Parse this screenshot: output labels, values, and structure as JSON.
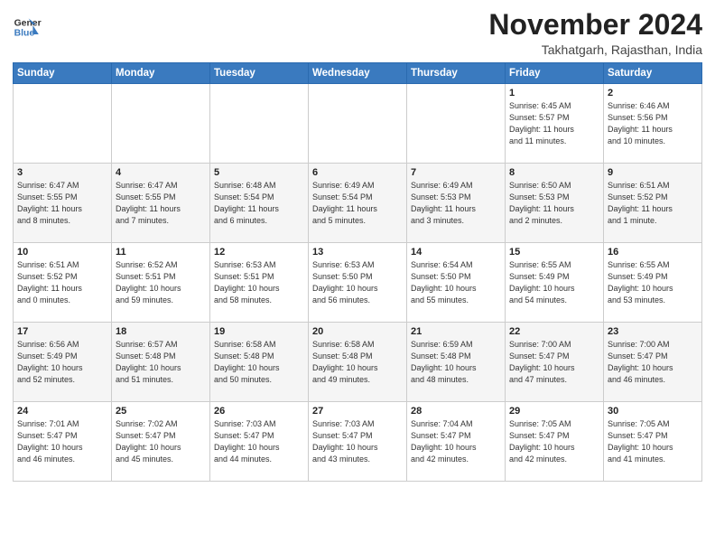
{
  "header": {
    "logo_line1": "General",
    "logo_line2": "Blue",
    "month": "November 2024",
    "location": "Takhatgarh, Rajasthan, India"
  },
  "weekdays": [
    "Sunday",
    "Monday",
    "Tuesday",
    "Wednesday",
    "Thursday",
    "Friday",
    "Saturday"
  ],
  "weeks": [
    [
      {
        "day": "",
        "info": ""
      },
      {
        "day": "",
        "info": ""
      },
      {
        "day": "",
        "info": ""
      },
      {
        "day": "",
        "info": ""
      },
      {
        "day": "",
        "info": ""
      },
      {
        "day": "1",
        "info": "Sunrise: 6:45 AM\nSunset: 5:57 PM\nDaylight: 11 hours\nand 11 minutes."
      },
      {
        "day": "2",
        "info": "Sunrise: 6:46 AM\nSunset: 5:56 PM\nDaylight: 11 hours\nand 10 minutes."
      }
    ],
    [
      {
        "day": "3",
        "info": "Sunrise: 6:47 AM\nSunset: 5:55 PM\nDaylight: 11 hours\nand 8 minutes."
      },
      {
        "day": "4",
        "info": "Sunrise: 6:47 AM\nSunset: 5:55 PM\nDaylight: 11 hours\nand 7 minutes."
      },
      {
        "day": "5",
        "info": "Sunrise: 6:48 AM\nSunset: 5:54 PM\nDaylight: 11 hours\nand 6 minutes."
      },
      {
        "day": "6",
        "info": "Sunrise: 6:49 AM\nSunset: 5:54 PM\nDaylight: 11 hours\nand 5 minutes."
      },
      {
        "day": "7",
        "info": "Sunrise: 6:49 AM\nSunset: 5:53 PM\nDaylight: 11 hours\nand 3 minutes."
      },
      {
        "day": "8",
        "info": "Sunrise: 6:50 AM\nSunset: 5:53 PM\nDaylight: 11 hours\nand 2 minutes."
      },
      {
        "day": "9",
        "info": "Sunrise: 6:51 AM\nSunset: 5:52 PM\nDaylight: 11 hours\nand 1 minute."
      }
    ],
    [
      {
        "day": "10",
        "info": "Sunrise: 6:51 AM\nSunset: 5:52 PM\nDaylight: 11 hours\nand 0 minutes."
      },
      {
        "day": "11",
        "info": "Sunrise: 6:52 AM\nSunset: 5:51 PM\nDaylight: 10 hours\nand 59 minutes."
      },
      {
        "day": "12",
        "info": "Sunrise: 6:53 AM\nSunset: 5:51 PM\nDaylight: 10 hours\nand 58 minutes."
      },
      {
        "day": "13",
        "info": "Sunrise: 6:53 AM\nSunset: 5:50 PM\nDaylight: 10 hours\nand 56 minutes."
      },
      {
        "day": "14",
        "info": "Sunrise: 6:54 AM\nSunset: 5:50 PM\nDaylight: 10 hours\nand 55 minutes."
      },
      {
        "day": "15",
        "info": "Sunrise: 6:55 AM\nSunset: 5:49 PM\nDaylight: 10 hours\nand 54 minutes."
      },
      {
        "day": "16",
        "info": "Sunrise: 6:55 AM\nSunset: 5:49 PM\nDaylight: 10 hours\nand 53 minutes."
      }
    ],
    [
      {
        "day": "17",
        "info": "Sunrise: 6:56 AM\nSunset: 5:49 PM\nDaylight: 10 hours\nand 52 minutes."
      },
      {
        "day": "18",
        "info": "Sunrise: 6:57 AM\nSunset: 5:48 PM\nDaylight: 10 hours\nand 51 minutes."
      },
      {
        "day": "19",
        "info": "Sunrise: 6:58 AM\nSunset: 5:48 PM\nDaylight: 10 hours\nand 50 minutes."
      },
      {
        "day": "20",
        "info": "Sunrise: 6:58 AM\nSunset: 5:48 PM\nDaylight: 10 hours\nand 49 minutes."
      },
      {
        "day": "21",
        "info": "Sunrise: 6:59 AM\nSunset: 5:48 PM\nDaylight: 10 hours\nand 48 minutes."
      },
      {
        "day": "22",
        "info": "Sunrise: 7:00 AM\nSunset: 5:47 PM\nDaylight: 10 hours\nand 47 minutes."
      },
      {
        "day": "23",
        "info": "Sunrise: 7:00 AM\nSunset: 5:47 PM\nDaylight: 10 hours\nand 46 minutes."
      }
    ],
    [
      {
        "day": "24",
        "info": "Sunrise: 7:01 AM\nSunset: 5:47 PM\nDaylight: 10 hours\nand 46 minutes."
      },
      {
        "day": "25",
        "info": "Sunrise: 7:02 AM\nSunset: 5:47 PM\nDaylight: 10 hours\nand 45 minutes."
      },
      {
        "day": "26",
        "info": "Sunrise: 7:03 AM\nSunset: 5:47 PM\nDaylight: 10 hours\nand 44 minutes."
      },
      {
        "day": "27",
        "info": "Sunrise: 7:03 AM\nSunset: 5:47 PM\nDaylight: 10 hours\nand 43 minutes."
      },
      {
        "day": "28",
        "info": "Sunrise: 7:04 AM\nSunset: 5:47 PM\nDaylight: 10 hours\nand 42 minutes."
      },
      {
        "day": "29",
        "info": "Sunrise: 7:05 AM\nSunset: 5:47 PM\nDaylight: 10 hours\nand 42 minutes."
      },
      {
        "day": "30",
        "info": "Sunrise: 7:05 AM\nSunset: 5:47 PM\nDaylight: 10 hours\nand 41 minutes."
      }
    ]
  ]
}
